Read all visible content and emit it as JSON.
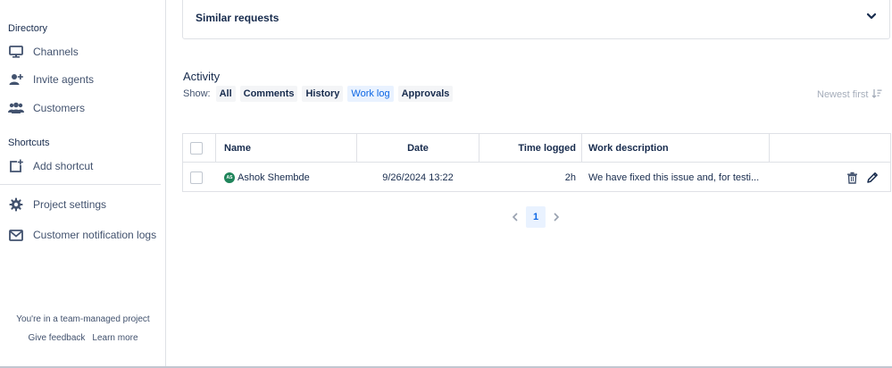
{
  "sidebar": {
    "directory_title": "Directory",
    "items": [
      {
        "label": "Channels",
        "icon": "monitor-icon"
      },
      {
        "label": "Invite agents",
        "icon": "add-user-icon"
      },
      {
        "label": "Customers",
        "icon": "people-icon"
      }
    ],
    "shortcuts_title": "Shortcuts",
    "shortcut_items": [
      {
        "label": "Add shortcut",
        "icon": "add-shortcut-icon"
      }
    ],
    "bottom_items": [
      {
        "label": "Project settings",
        "icon": "gear-icon"
      },
      {
        "label": "Customer notification logs",
        "icon": "mail-icon"
      }
    ],
    "footer_note": "You're in a team-managed project",
    "footer_links": [
      "Give feedback",
      "Learn more"
    ]
  },
  "similar": {
    "title": "Similar requests"
  },
  "activity": {
    "title": "Activity",
    "show_label": "Show:",
    "filters": [
      "All",
      "Comments",
      "History",
      "Work log",
      "Approvals"
    ],
    "active_filter": "Work log",
    "sort_label": "Newest first"
  },
  "table": {
    "headers": [
      "Name",
      "Date",
      "Time logged",
      "Work description"
    ],
    "rows": [
      {
        "avatar_initials": "AS",
        "name": "Ashok Shembde",
        "date": "9/26/2024 13:22",
        "time_logged": "2h",
        "description": "We have fixed this issue and, for testi..."
      }
    ]
  },
  "pagination": {
    "current_page": "1"
  },
  "colors": {
    "accent": "#0c66e4",
    "avatar": "#1f845a",
    "border": "#dfe1e6"
  }
}
